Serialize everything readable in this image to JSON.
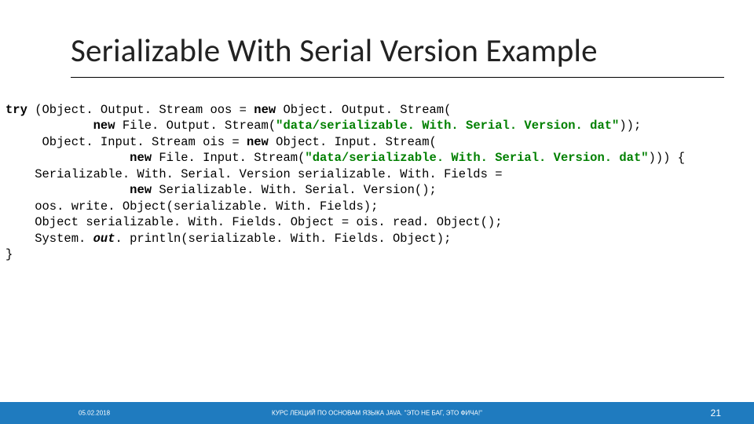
{
  "slide": {
    "title": "Serializable With Serial Version Example",
    "code": {
      "l1a": "try",
      "l1b": " (Object. Output. Stream oos = ",
      "l1c": "new",
      "l1d": " Object. Output. Stream(",
      "l2a": "            ",
      "l2b": "new",
      "l2c": " File. Output. Stream(",
      "l2d": "\"data/serializable. With. Serial. Version. dat\"",
      "l2e": "));",
      "l3a": "     Object. Input. Stream ois = ",
      "l3b": "new",
      "l3c": " Object. Input. Stream(",
      "l4a": "                 ",
      "l4b": "new",
      "l4c": " File. Input. Stream(",
      "l4d": "\"data/serializable. With. Serial. Version. dat\"",
      "l4e": "))) {",
      "l5": "    Serializable. With. Serial. Version serializable. With. Fields =",
      "l6a": "                 ",
      "l6b": "new",
      "l6c": " Serializable. With. Serial. Version();",
      "l7": "    oos. write. Object(serializable. With. Fields);",
      "l8": "    Object serializable. With. Fields. Object = ois. read. Object();",
      "l9a": "    System. ",
      "l9b": "out",
      "l9c": ". println(serializable. With. Fields. Object);",
      "l10": "}"
    },
    "footer": {
      "date": "05.02.2018",
      "caption": "КУРС ЛЕКЦИЙ ПО ОСНОВАМ ЯЗЫКА JAVA. \"ЭТО НЕ БАГ, ЭТО ФИЧА!\"",
      "page": "21"
    }
  }
}
